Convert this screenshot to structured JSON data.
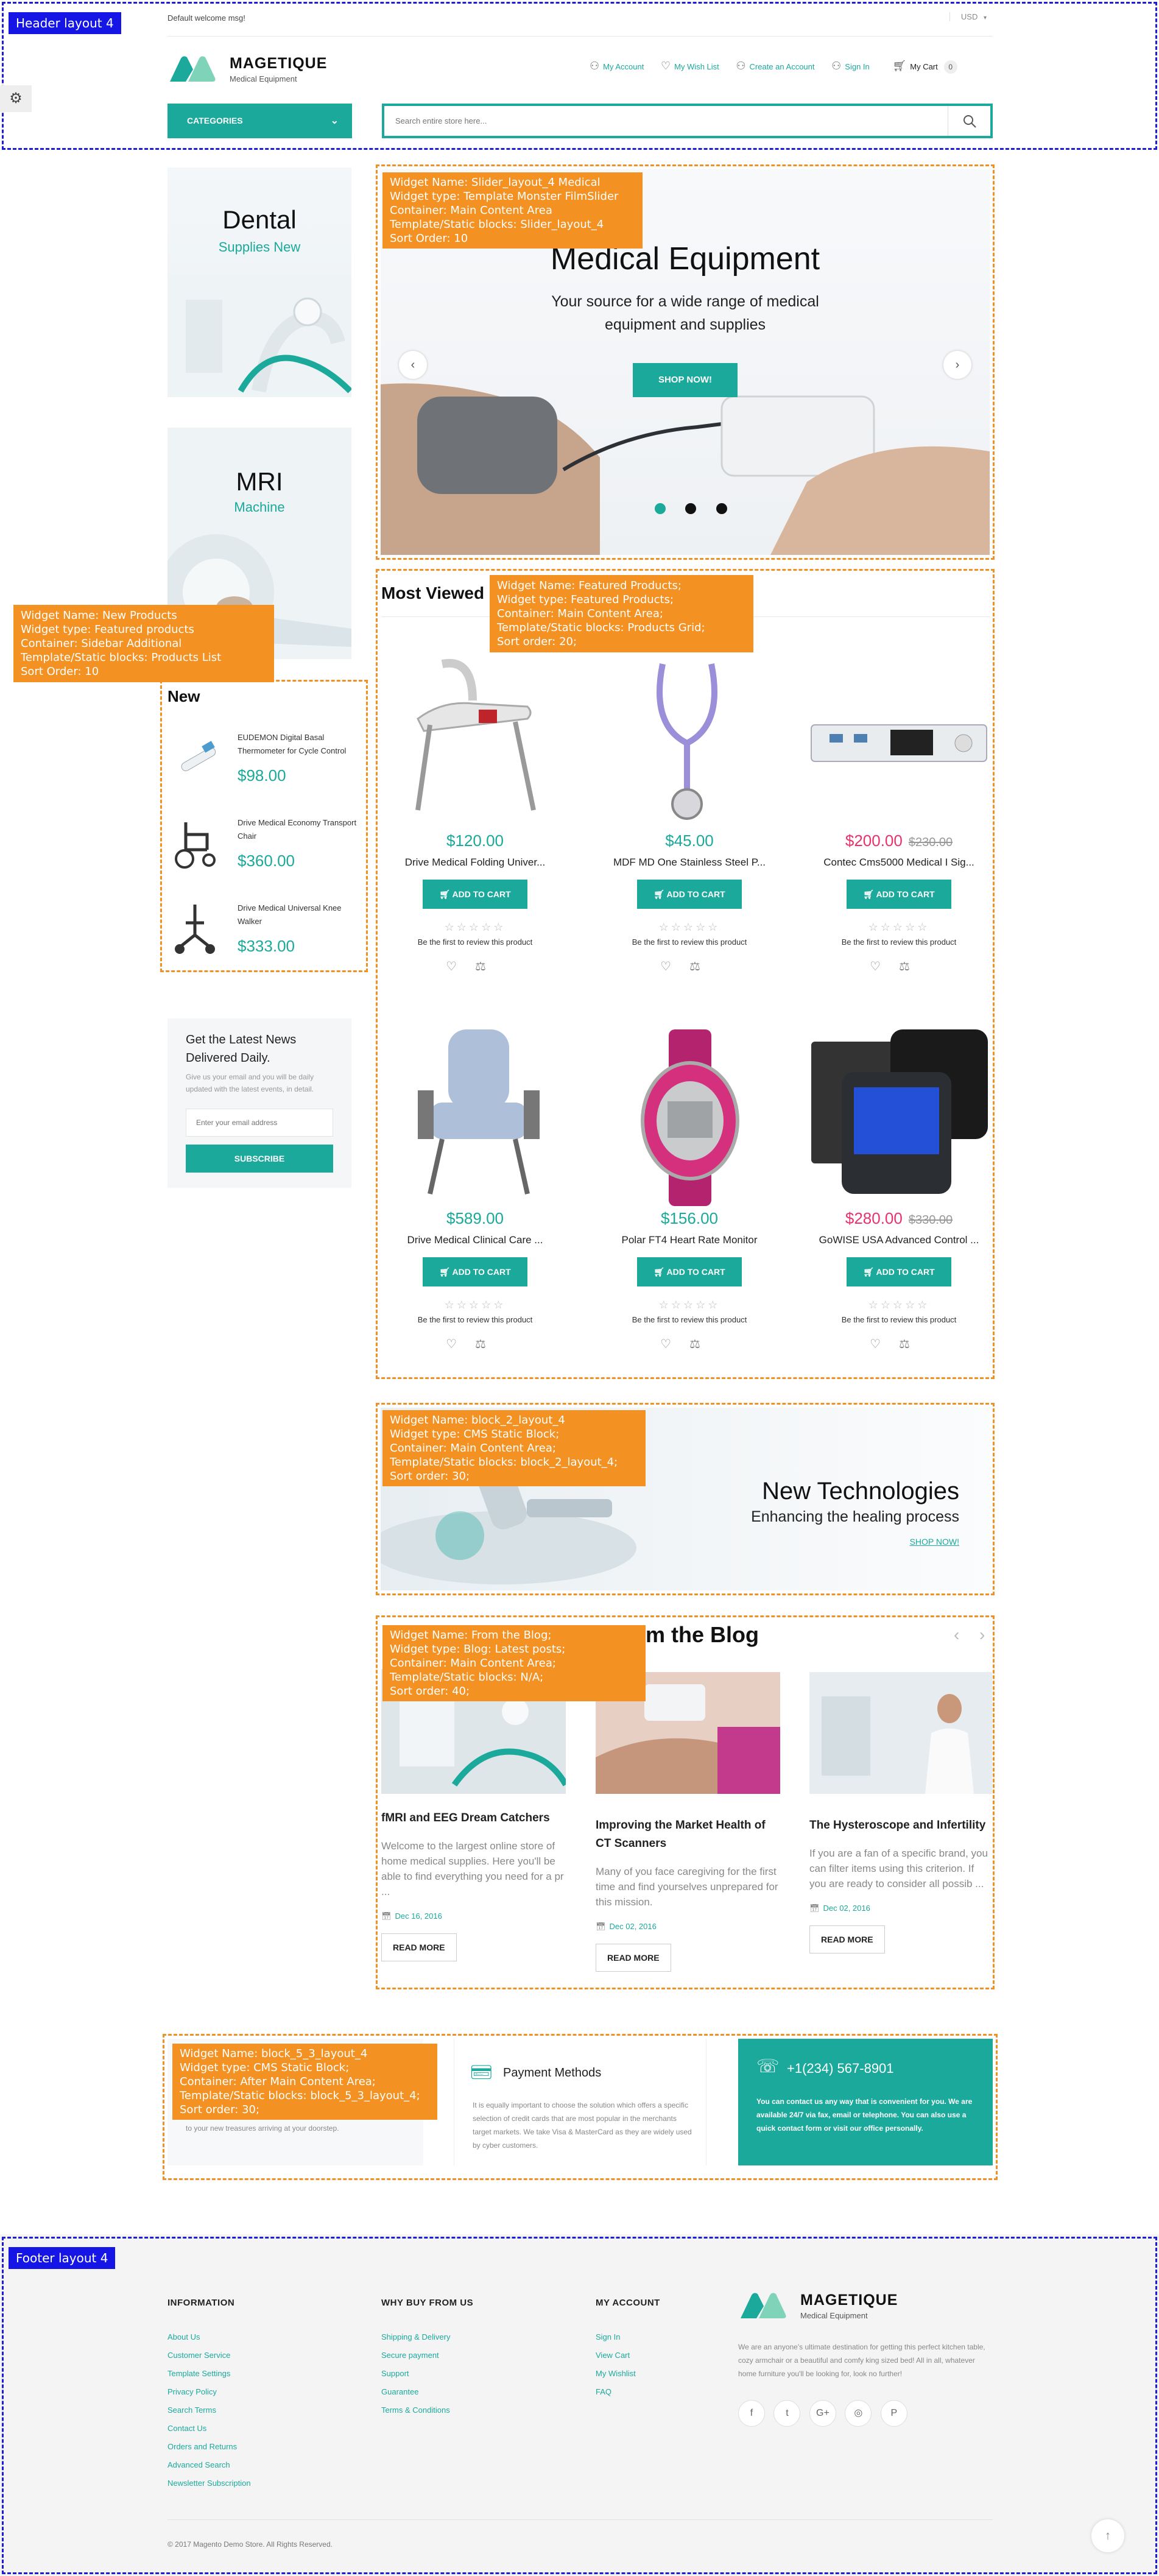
{
  "annot": {
    "header": "Header layout 4",
    "footer": "Footer layout 4",
    "slider": [
      "Widget Name: Slider_layout_4 Medical",
      "Widget type: Template Monster FilmSlider",
      "Container: Main Content Area",
      "Template/Static blocks: Slider_layout_4",
      "Sort Order: 10"
    ],
    "new_products": [
      "Widget Name:   New Products",
      "Widget type: Featured products",
      "Container: Sidebar Additional",
      "Template/Static blocks: Products List",
      "Sort Order: 10"
    ],
    "featured": [
      "Widget Name: Featured Products;",
      "Widget type: Featured Products;",
      "Container: Main Content Area;",
      "Template/Static blocks: Products Grid;",
      "Sort order: 20;"
    ],
    "block2": [
      "Widget Name: block_2_layout_4",
      "Widget type: CMS Static Block;",
      "Container: Main Content Area;",
      "Template/Static blocks: block_2_layout_4;",
      "Sort order: 30;"
    ],
    "blog": [
      "Widget Name: From the Blog;",
      "Widget type: Blog: Latest posts;",
      "Container: Main Content Area;",
      "Template/Static blocks: N/A;",
      "Sort order: 40;"
    ],
    "block5": [
      "Widget Name: block_5_3_layout_4",
      "Widget type: CMS Static Block;",
      "Container: After Main Content Area;",
      "Template/Static blocks: block_5_3_layout_4;",
      "Sort order: 30;"
    ]
  },
  "topbar": {
    "welcome": "Default welcome msg!",
    "currency": "USD"
  },
  "header": {
    "logo_title": "MAGETIQUE",
    "logo_sub": "Medical Equipment",
    "links": [
      "My Account",
      "My Wish List",
      "Create an Account",
      "Sign In"
    ],
    "cart_label": "My Cart",
    "cart_count": "0",
    "categories": "CATEGORIES",
    "search_placeholder": "Search entire store here..."
  },
  "sidebar": {
    "banner1": {
      "title": "Dental",
      "sub": "Supplies New"
    },
    "banner2": {
      "title": "MRI",
      "sub": "Machine"
    },
    "new_title": "New",
    "new_products": [
      {
        "name": "EUDEMON Digital Basal Thermometer for Cycle Control",
        "price": "$98.00"
      },
      {
        "name": "Drive Medical Economy Transport Chair",
        "price": "$360.00"
      },
      {
        "name": "Drive Medical Universal Knee Walker",
        "price": "$333.00"
      }
    ],
    "newsletter": {
      "title": "Get the Latest News Delivered Daily.",
      "text": "Give us your email and you will be daily updated with the latest events, in detail.",
      "placeholder": "Enter your email address",
      "button": "SUBSCRIBE"
    }
  },
  "slider": {
    "title": "Medical Equipment",
    "text": "Your source for a wide range of medical equipment and supplies",
    "button": "SHOP NOW!"
  },
  "featured": {
    "title": "Most Viewed",
    "add_to_cart": "ADD TO CART",
    "review": "Be the first to review this product",
    "products": [
      {
        "price": "$120.00",
        "old": "",
        "name": "Drive Medical Folding Univer...",
        "sale": false
      },
      {
        "price": "$45.00",
        "old": "",
        "name": "MDF MD One Stainless Steel P...",
        "sale": false
      },
      {
        "price": "$200.00",
        "old": "$230.00",
        "name": "Contec Cms5000 Medical I Sig...",
        "sale": true
      },
      {
        "price": "$589.00",
        "old": "",
        "name": "Drive Medical Clinical Care ...",
        "sale": false
      },
      {
        "price": "$156.00",
        "old": "",
        "name": "Polar FT4 Heart Rate Monitor",
        "sale": false
      },
      {
        "price": "$280.00",
        "old": "$330.00",
        "name": "GoWISE USA Advanced Control ...",
        "sale": true
      }
    ]
  },
  "banner_tech": {
    "title": "New Technologies",
    "sub": "Enhancing the healing process",
    "link": "SHOP NOW!"
  },
  "blog": {
    "title": "From the Blog",
    "title_visible": "m the Blog",
    "read_more": "READ MORE",
    "posts": [
      {
        "title": "fMRI and EEG Dream Catchers",
        "text": "Welcome to the largest online store of home medical supplies. Here you'll be able to find everything you need for a pr ...",
        "date": "Dec 16, 2016"
      },
      {
        "title": "Improving the Market Health of CT Scanners",
        "text": "Many of you face caregiving for the first time and find yourselves unprepared for this mission.",
        "date": "Dec 02, 2016"
      },
      {
        "title": "The Hysteroscope and Infertility",
        "text": "If you are a fan of a specific brand, you can filter items using this criterion. If you are ready to consider all possib ...",
        "date": "Dec 02, 2016"
      }
    ]
  },
  "info_blocks": {
    "left_text": "to your new treasures arriving at your doorstep.",
    "payment_title": "Payment Methods",
    "payment_text": "It is equally important to choose the solution which offers a specific selection of credit cards that are most popular in the merchants target markets. We take Visa & MasterCard as they are widely used by cyber customers.",
    "phone": "+1(234) 567-8901",
    "phone_text": "You can contact us any way that is convenient for you. We are available 24/7 via fax, email or telephone. You can also use a quick contact form or visit our office personally."
  },
  "footer": {
    "information": {
      "title": "INFORMATION",
      "links": [
        "About Us",
        "Customer Service",
        "Template Settings",
        "Privacy Policy",
        "Search Terms",
        "Contact Us",
        "Orders and Returns",
        "Advanced Search",
        "Newsletter Subscription"
      ]
    },
    "why": {
      "title": "WHY BUY FROM US",
      "links": [
        "Shipping & Delivery",
        "Secure payment",
        "Support",
        "Guarantee",
        "Terms & Conditions"
      ]
    },
    "account": {
      "title": "MY ACCOUNT",
      "links": [
        "Sign In",
        "View Cart",
        "My Wishlist",
        "FAQ"
      ]
    },
    "logo_title": "MAGETIQUE",
    "logo_sub": "Medical Equipment",
    "about": "We are an anyone's ultimate destination for getting this perfect kitchen table, cozy armchair or a beautiful and comfy king sized bed! All in all, whatever home furniture you'll be looking for, look no further!",
    "social": [
      "f",
      "t",
      "G+",
      "◎",
      "P"
    ],
    "copyright": "© 2017 Magento Demo Store. All Rights Reserved."
  },
  "colors": {
    "accent": "#1aa99b",
    "sale": "#e8336d",
    "annotation_orange": "#f39122",
    "annotation_blue": "#1515e6"
  }
}
